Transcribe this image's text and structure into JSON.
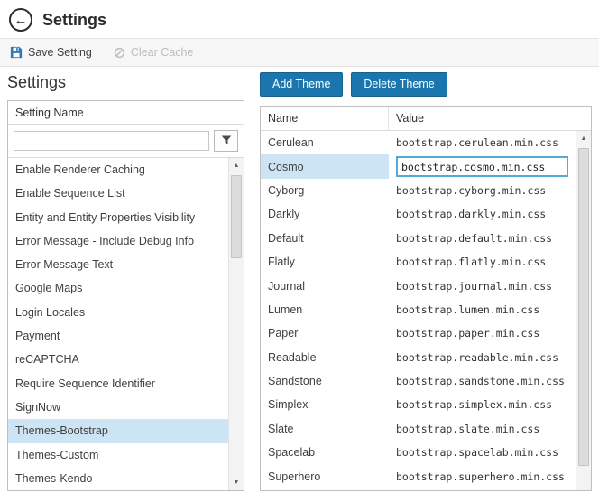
{
  "header": {
    "title": "Settings"
  },
  "toolbar": {
    "save_label": "Save Setting",
    "clear_label": "Clear Cache"
  },
  "left_panel": {
    "title": "Settings",
    "grid": {
      "column_header": "Setting Name",
      "filter_value": "",
      "selected_item": "Themes-Bootstrap",
      "items": [
        "Enable Renderer Caching",
        "Enable Sequence List",
        "Entity and Entity Properties Visibility",
        "Error Message - Include Debug Info",
        "Error Message Text",
        "Google Maps",
        "Login Locales",
        "Payment",
        "reCAPTCHA",
        "Require Sequence Identifier",
        "SignNow",
        "Themes-Bootstrap",
        "Themes-Custom",
        "Themes-Kendo"
      ]
    }
  },
  "right_panel": {
    "add_label": "Add Theme",
    "delete_label": "Delete Theme",
    "grid": {
      "columns": [
        "Name",
        "Value"
      ],
      "selected_row": "Cosmo",
      "editing_value": "bootstrap.cosmo.min.css",
      "rows": [
        {
          "name": "Cerulean",
          "value": "bootstrap.cerulean.min.css"
        },
        {
          "name": "Cosmo",
          "value": "bootstrap.cosmo.min.css"
        },
        {
          "name": "Cyborg",
          "value": "bootstrap.cyborg.min.css"
        },
        {
          "name": "Darkly",
          "value": "bootstrap.darkly.min.css"
        },
        {
          "name": "Default",
          "value": "bootstrap.default.min.css"
        },
        {
          "name": "Flatly",
          "value": "bootstrap.flatly.min.css"
        },
        {
          "name": "Journal",
          "value": "bootstrap.journal.min.css"
        },
        {
          "name": "Lumen",
          "value": "bootstrap.lumen.min.css"
        },
        {
          "name": "Paper",
          "value": "bootstrap.paper.min.css"
        },
        {
          "name": "Readable",
          "value": "bootstrap.readable.min.css"
        },
        {
          "name": "Sandstone",
          "value": "bootstrap.sandstone.min.css"
        },
        {
          "name": "Simplex",
          "value": "bootstrap.simplex.min.css"
        },
        {
          "name": "Slate",
          "value": "bootstrap.slate.min.css"
        },
        {
          "name": "Spacelab",
          "value": "bootstrap.spacelab.min.css"
        },
        {
          "name": "Superhero",
          "value": "bootstrap.superhero.min.css"
        }
      ]
    }
  },
  "colors": {
    "accent_blue": "#1a76ad",
    "selection_blue": "#cde4f4",
    "edit_border_blue": "#54a9d8",
    "save_icon_blue": "#2f79b9"
  }
}
